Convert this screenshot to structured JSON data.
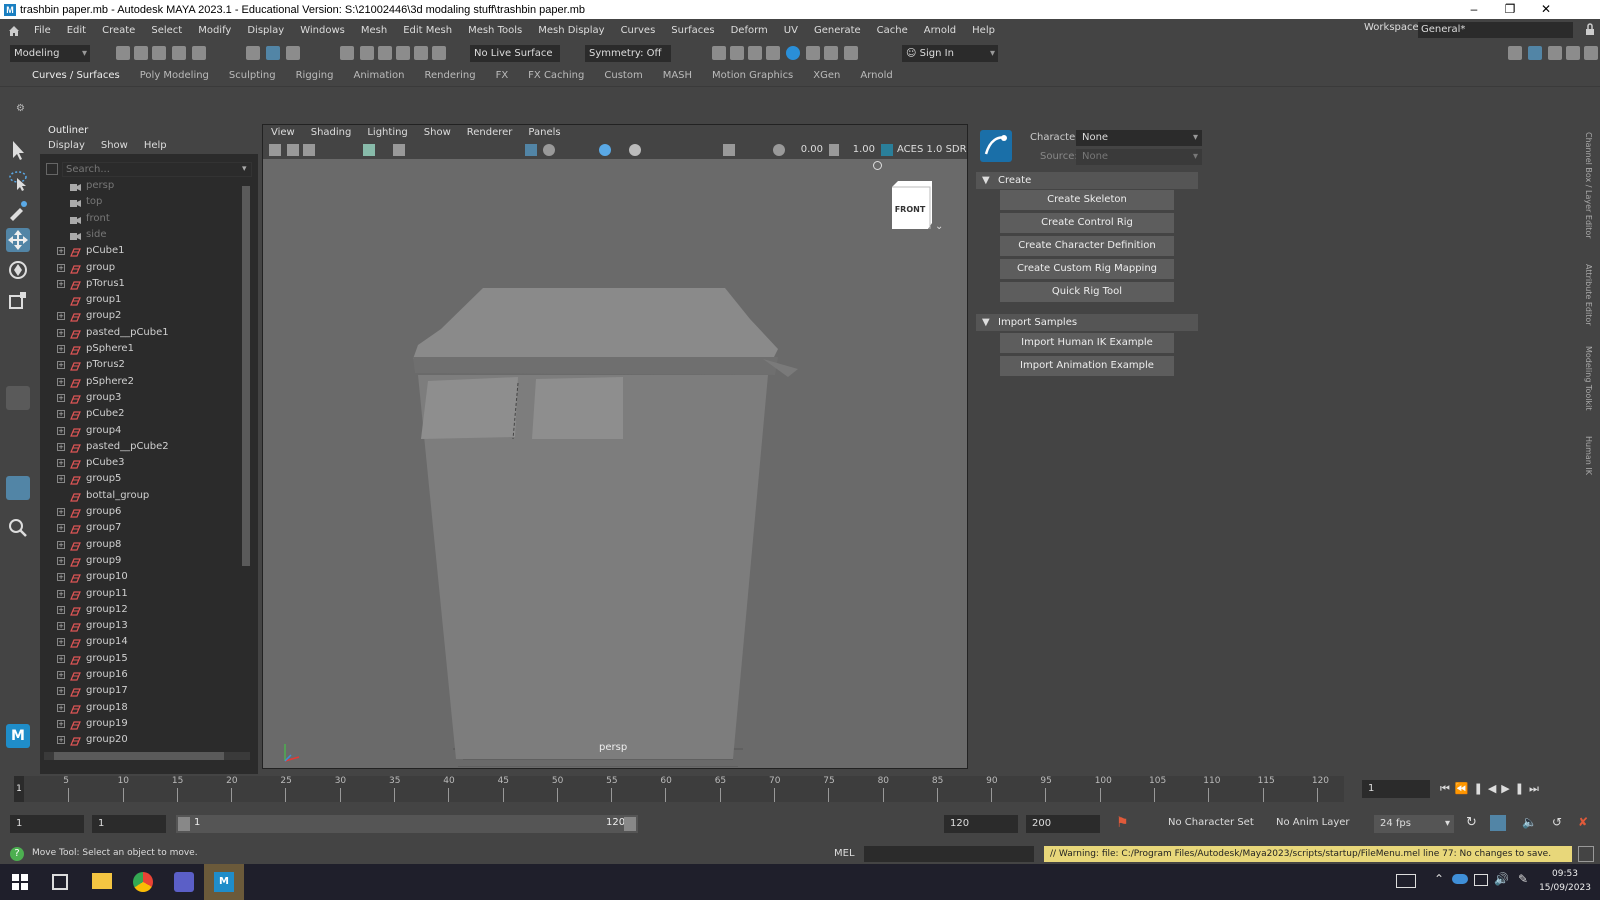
{
  "window": {
    "title": "trashbin paper.mb - Autodesk MAYA 2023.1 - Educational Version: S:\\21002446\\3d modaling stuff\\trashbin paper.mb",
    "app_icon": "M"
  },
  "menubar": {
    "items": [
      "File",
      "Edit",
      "Create",
      "Select",
      "Modify",
      "Display",
      "Windows",
      "Mesh",
      "Edit Mesh",
      "Mesh Tools",
      "Mesh Display",
      "Curves",
      "Surfaces",
      "Deform",
      "UV",
      "Generate",
      "Cache",
      "Arnold",
      "Help"
    ],
    "workspace_label": "Workspace:",
    "workspace_value": "General*"
  },
  "statusline": {
    "mode": "Modeling",
    "live_surface": "No Live Surface",
    "symmetry": "Symmetry: Off",
    "sign_in": "Sign In"
  },
  "shelf": {
    "tabs": [
      "Curves / Surfaces",
      "Poly Modeling",
      "Sculpting",
      "Rigging",
      "Animation",
      "Rendering",
      "FX",
      "FX Caching",
      "Custom",
      "MASH",
      "Motion Graphics",
      "XGen",
      "Arnold"
    ],
    "active_tab": "Curves / Surfaces"
  },
  "outliner": {
    "title": "Outliner",
    "menu": [
      "Display",
      "Show",
      "Help"
    ],
    "search_placeholder": "Search...",
    "rows": [
      {
        "label": "persp",
        "type": "camera",
        "expand": false
      },
      {
        "label": "top",
        "type": "camera",
        "expand": false
      },
      {
        "label": "front",
        "type": "camera",
        "expand": false
      },
      {
        "label": "side",
        "type": "camera",
        "expand": false
      },
      {
        "label": "pCube1",
        "type": "mesh",
        "expand": true
      },
      {
        "label": "group",
        "type": "mesh",
        "expand": true
      },
      {
        "label": "pTorus1",
        "type": "mesh",
        "expand": true
      },
      {
        "label": "group1",
        "type": "mesh",
        "expand": false
      },
      {
        "label": "group2",
        "type": "mesh",
        "expand": true
      },
      {
        "label": "pasted__pCube1",
        "type": "mesh",
        "expand": true
      },
      {
        "label": "pSphere1",
        "type": "mesh",
        "expand": true
      },
      {
        "label": "pTorus2",
        "type": "mesh",
        "expand": true
      },
      {
        "label": "pSphere2",
        "type": "mesh",
        "expand": true
      },
      {
        "label": "group3",
        "type": "mesh",
        "expand": true
      },
      {
        "label": "pCube2",
        "type": "mesh",
        "expand": true
      },
      {
        "label": "group4",
        "type": "mesh",
        "expand": true
      },
      {
        "label": "pasted__pCube2",
        "type": "mesh",
        "expand": true
      },
      {
        "label": "pCube3",
        "type": "mesh",
        "expand": true
      },
      {
        "label": "group5",
        "type": "mesh",
        "expand": true
      },
      {
        "label": "bottal_group",
        "type": "mesh",
        "expand": false
      },
      {
        "label": "group6",
        "type": "mesh",
        "expand": true
      },
      {
        "label": "group7",
        "type": "mesh",
        "expand": true
      },
      {
        "label": "group8",
        "type": "mesh",
        "expand": true
      },
      {
        "label": "group9",
        "type": "mesh",
        "expand": true
      },
      {
        "label": "group10",
        "type": "mesh",
        "expand": true
      },
      {
        "label": "group11",
        "type": "mesh",
        "expand": true
      },
      {
        "label": "group12",
        "type": "mesh",
        "expand": true
      },
      {
        "label": "group13",
        "type": "mesh",
        "expand": true
      },
      {
        "label": "group14",
        "type": "mesh",
        "expand": true
      },
      {
        "label": "group15",
        "type": "mesh",
        "expand": true
      },
      {
        "label": "group16",
        "type": "mesh",
        "expand": true
      },
      {
        "label": "group17",
        "type": "mesh",
        "expand": true
      },
      {
        "label": "group18",
        "type": "mesh",
        "expand": true
      },
      {
        "label": "group19",
        "type": "mesh",
        "expand": true
      },
      {
        "label": "group20",
        "type": "mesh",
        "expand": true
      }
    ]
  },
  "viewport": {
    "menu": [
      "View",
      "Shading",
      "Lighting",
      "Show",
      "Renderer",
      "Panels"
    ],
    "field_a": "0.00",
    "field_b": "1.00",
    "color_space": "ACES 1.0 SDR",
    "viewcube_label": "FRONT",
    "camera_label": "persp"
  },
  "humanik": {
    "character_label": "Character:",
    "character_value": "None",
    "source_label": "Source:",
    "source_value": "None",
    "section_create": "Create",
    "create_buttons": [
      "Create Skeleton",
      "Create Control Rig",
      "Create Character Definition",
      "Create Custom Rig Mapping",
      "Quick Rig Tool"
    ],
    "section_import": "Import Samples",
    "import_buttons": [
      "Import Human IK Example",
      "Import Animation Example"
    ]
  },
  "right_tabs": [
    "Channel Box / Layer Editor",
    "Attribute Editor",
    "Modeling Toolkit",
    "Human IK"
  ],
  "timeline": {
    "ticks": [
      "5",
      "10",
      "15",
      "20",
      "25",
      "30",
      "35",
      "40",
      "45",
      "50",
      "55",
      "60",
      "65",
      "70",
      "75",
      "80",
      "85",
      "90",
      "95",
      "100",
      "105",
      "110",
      "115",
      "120"
    ],
    "current_frame_marker": "1",
    "current_frame": "1"
  },
  "range": {
    "start_a": "1",
    "start_b": "1",
    "slider_start": "1",
    "slider_end": "120",
    "end_a": "120",
    "end_b": "200",
    "character_set": "No Character Set",
    "anim_layer": "No Anim Layer",
    "fps": "24 fps"
  },
  "helpline": {
    "help": "Move Tool: Select an object to move.",
    "mel": "MEL",
    "warning": "// Warning: file: C:/Program Files/Autodesk/Maya2023/scripts/startup/FileMenu.mel line 77: No changes to save."
  },
  "taskbar": {
    "time": "09:53",
    "date": "15/09/2023"
  },
  "colors": {
    "panel": "#444444",
    "field": "#2b2b2b",
    "viewport": "#6a6a6a",
    "active_tool": "#5285a6",
    "warning_bg": "#e8d77a",
    "taskbar": "#1f1f2b"
  }
}
